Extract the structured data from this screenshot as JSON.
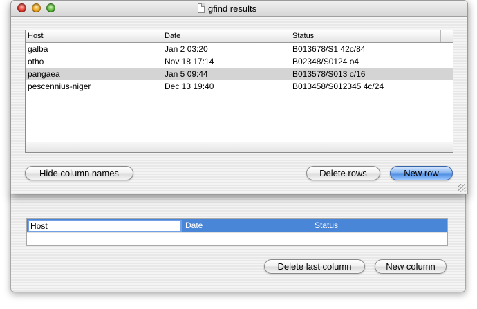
{
  "window": {
    "title": "gfind results"
  },
  "table": {
    "columns": [
      "Host",
      "Date",
      "Status"
    ],
    "rows": [
      {
        "host": "galba",
        "date": "Jan  2 03:20",
        "status": "B013678/S1 42c/84",
        "selected": false
      },
      {
        "host": "otho",
        "date": "Nov 18 17:14",
        "status": "B02348/S0124 o4",
        "selected": false
      },
      {
        "host": "pangaea",
        "date": "Jan  5 09:44",
        "status": "B013578/S013 c/16",
        "selected": true
      },
      {
        "host": "pescennius-niger",
        "date": "Dec 13 19:40",
        "status": "B013458/S012345 4c/24",
        "selected": false
      }
    ]
  },
  "buttons": {
    "hide_column_names": "Hide column names",
    "delete_rows": "Delete rows",
    "new_row": "New row",
    "delete_last_column": "Delete last column",
    "new_column": "New column"
  },
  "column_editor": {
    "host_value": "Host",
    "date_label": "Date",
    "status_label": "Status"
  },
  "colors": {
    "selection_gray": "#d4d4d4",
    "header_blue": "#4a86d8"
  }
}
